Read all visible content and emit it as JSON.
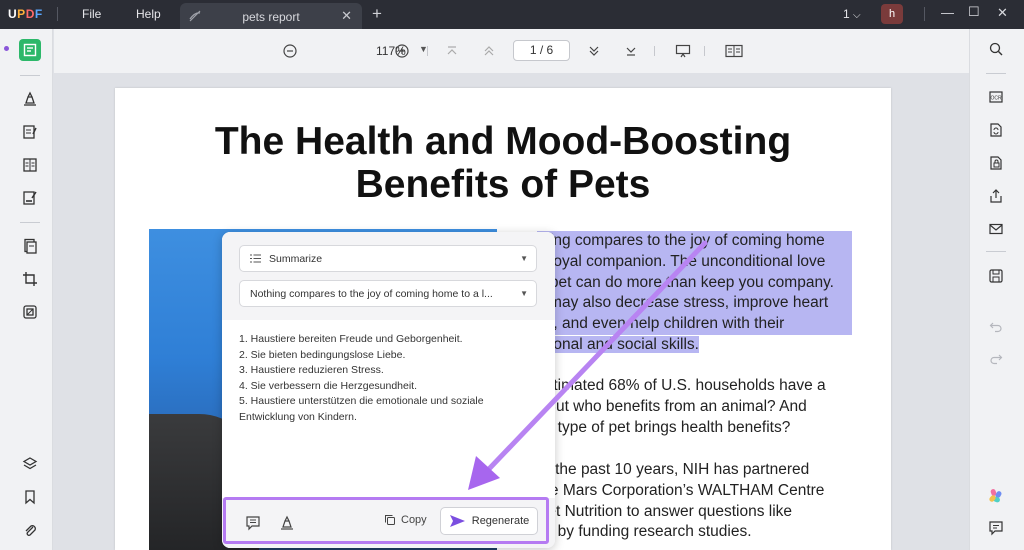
{
  "app": {
    "logo_parts": [
      "U",
      "P",
      "D",
      "F"
    ],
    "menu": [
      "File",
      "Help"
    ],
    "tab_title": "pets report",
    "version": "1",
    "avatar_initial": "h"
  },
  "toolbar": {
    "zoom": "117%",
    "page_indicator": "1 / 6"
  },
  "document": {
    "title_line1": "The Health and Mood-Boosting",
    "title_line2": "Benefits of Pets",
    "para1": [
      "thing compares to the joy of coming home",
      "a loyal companion. The unconditional love",
      "a pet can do more than keep you company.",
      "s may also decrease stress, improve heart",
      "lth, and even help children with their",
      "otional and social skills."
    ],
    "para2": [
      "estimated 68% of U.S. households have a",
      ". But who benefits from an animal? And",
      "ch type of pet brings health benefits?"
    ],
    "para3": [
      "er the past 10 years, NIH has partnered",
      "the Mars Corporation’s WALTHAM Centre",
      "Pet Nutrition to answer questions like",
      "se by funding research studies."
    ]
  },
  "ai_panel": {
    "mode": "Summarize",
    "prompt": "Nothing compares to the joy of coming home to a l...",
    "result": [
      "1. Haustiere bereiten Freude und Geborgenheit.",
      "2. Sie bieten bedingungslose Liebe.",
      "3. Haustiere reduzieren Stress.",
      "4. Sie verbessern die Herzgesundheit.",
      "5. Haustiere unterstützen die emotionale und soziale",
      "Entwicklung von Kindern."
    ],
    "copy_label": "Copy",
    "regenerate_label": "Regenerate"
  },
  "colors": {
    "accent_purple": "#b57bf2",
    "highlight": "#b7b6f2",
    "active_tool": "#2db86a",
    "titlebar": "#2b2d35"
  }
}
